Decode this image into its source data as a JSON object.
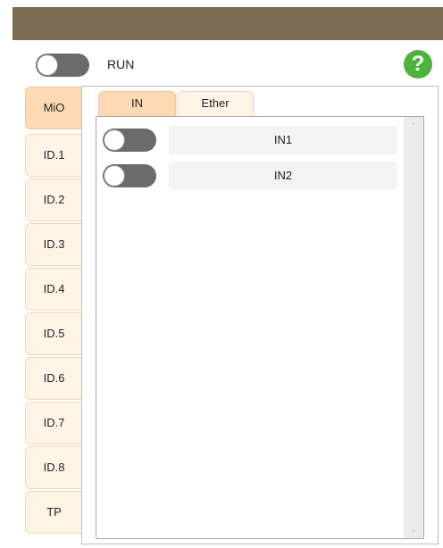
{
  "header": {
    "run_label": "RUN",
    "run_toggle_on": false,
    "help_glyph": "?"
  },
  "side_tabs": [
    {
      "label": "MiO",
      "active": true
    },
    {
      "label": "ID.1",
      "active": false
    },
    {
      "label": "ID.2",
      "active": false
    },
    {
      "label": "ID.3",
      "active": false
    },
    {
      "label": "ID.4",
      "active": false
    },
    {
      "label": "ID.5",
      "active": false
    },
    {
      "label": "ID.6",
      "active": false
    },
    {
      "label": "ID.7",
      "active": false
    },
    {
      "label": "ID.8",
      "active": false
    },
    {
      "label": "TP",
      "active": false
    }
  ],
  "top_tabs": [
    {
      "label": "IN",
      "active": true
    },
    {
      "label": "Ether",
      "active": false
    }
  ],
  "inputs": [
    {
      "label": "IN1",
      "on": false
    },
    {
      "label": "IN2",
      "on": false
    }
  ],
  "scrollbar": {
    "up_glyph": "⌃",
    "down_glyph": "⌄"
  },
  "colors": {
    "title_bar": "#7b6a52",
    "tab_active": "#ffd9b4",
    "tab_inactive": "#fff4e6",
    "toggle_off": "#6b6b6b",
    "help": "#4db33d"
  }
}
